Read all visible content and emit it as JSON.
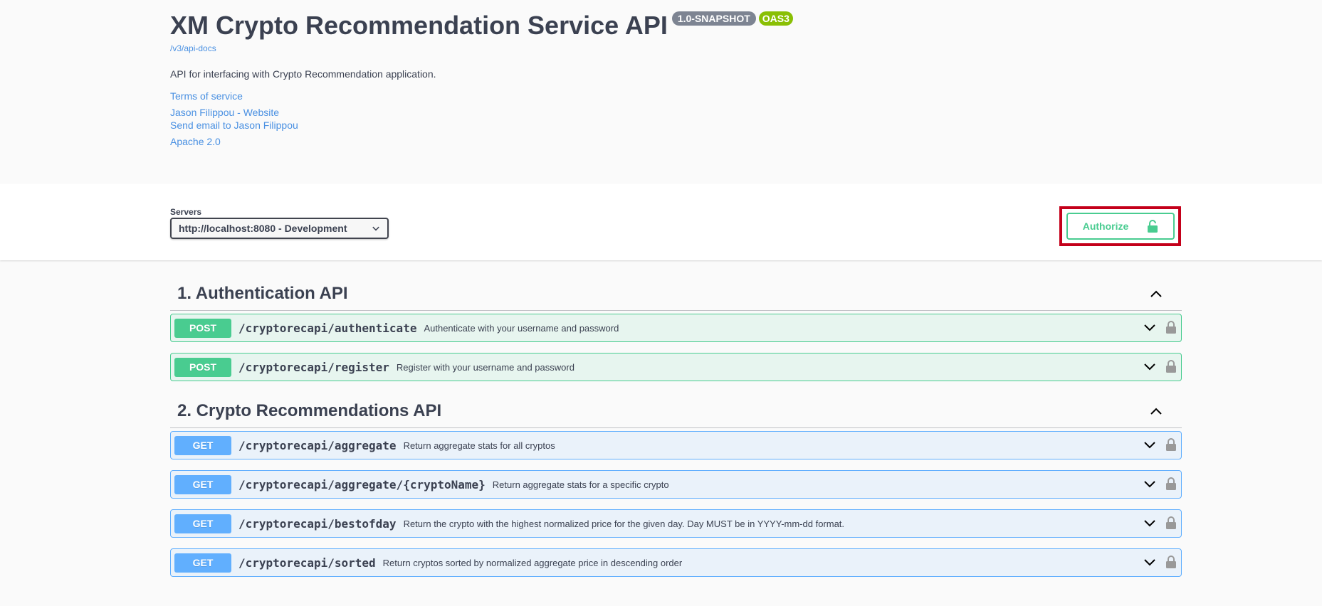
{
  "info": {
    "title": "XM Crypto Recommendation Service API",
    "version_badge": "1.0-SNAPSHOT",
    "oas_badge": "OAS3",
    "docs_link": "/v3/api-docs",
    "description": "API for interfacing with Crypto Recommendation application.",
    "links": {
      "terms": "Terms of service",
      "website": "Jason Filippou - Website",
      "email": "Send email to Jason Filippou",
      "license": "Apache 2.0"
    }
  },
  "servers": {
    "label": "Servers",
    "selected": "http://localhost:8080 - Development"
  },
  "authorize": {
    "label": "Authorize"
  },
  "tags": [
    {
      "title": "1. Authentication API",
      "operations": [
        {
          "method": "POST",
          "path": "/cryptorecapi/authenticate",
          "summary": "Authenticate with your username and password"
        },
        {
          "method": "POST",
          "path": "/cryptorecapi/register",
          "summary": "Register with your username and password"
        }
      ]
    },
    {
      "title": "2. Crypto Recommendations API",
      "operations": [
        {
          "method": "GET",
          "path": "/cryptorecapi/aggregate",
          "summary": "Return aggregate stats for all cryptos"
        },
        {
          "method": "GET",
          "path": "/cryptorecapi/aggregate/{cryptoName}",
          "summary": "Return aggregate stats for a specific crypto"
        },
        {
          "method": "GET",
          "path": "/cryptorecapi/bestofday",
          "summary": "Return the crypto with the highest normalized price for the given day. Day MUST be in YYYY-mm-dd format."
        },
        {
          "method": "GET",
          "path": "/cryptorecapi/sorted",
          "summary": "Return cryptos sorted by normalized aggregate price in descending order"
        }
      ]
    }
  ],
  "colors": {
    "post": "#49cc90",
    "get": "#61affe",
    "link": "#4990e2",
    "highlight": "#c4001a"
  },
  "icons": {
    "select_arrow": "chevron-down-icon",
    "collapse": "chevron-up-icon",
    "expand": "chevron-down-icon",
    "lock": "lock-icon",
    "unlock": "unlock-icon"
  }
}
